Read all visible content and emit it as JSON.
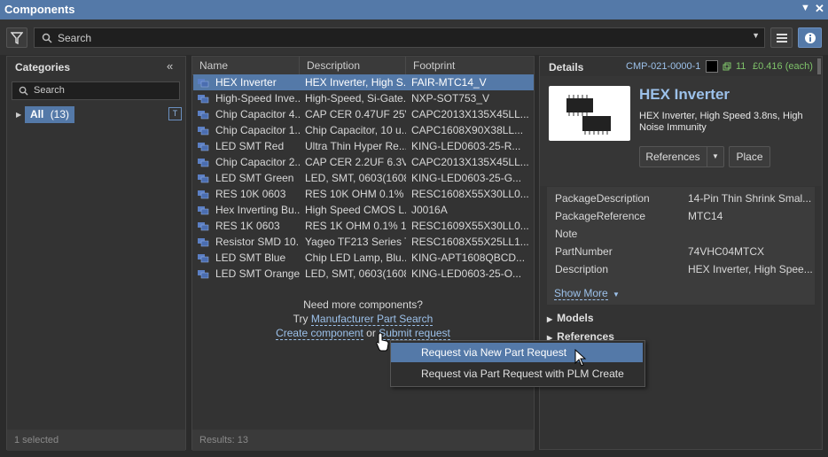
{
  "window": {
    "title": "Components",
    "dropdown_icon": "triangle-down-icon",
    "close_icon": "close-icon"
  },
  "toolbar": {
    "search_placeholder": "Search"
  },
  "categories": {
    "title": "Categories",
    "search_placeholder": "Search",
    "all_label": "All",
    "all_count": "(13)",
    "status": "1 selected"
  },
  "list": {
    "columns": [
      "Name",
      "Description",
      "Footprint"
    ],
    "rows": [
      {
        "name": "HEX Inverter",
        "desc": "HEX Inverter, High S...",
        "fp": "FAIR-MTC14_V"
      },
      {
        "name": "High-Speed Inve...",
        "desc": "High-Speed, Si-Gate...",
        "fp": "NXP-SOT753_V"
      },
      {
        "name": "Chip Capacitor 4...",
        "desc": "CAP CER 0.47UF 25V...",
        "fp": "CAPC2013X135X45LL..."
      },
      {
        "name": "Chip Capacitor 1...",
        "desc": "Chip Capacitor, 10 u...",
        "fp": "CAPC1608X90X38LL..."
      },
      {
        "name": "LED SMT Red",
        "desc": "Ultra Thin Hyper Re...",
        "fp": "KING-LED0603-25-R..."
      },
      {
        "name": "Chip Capacitor 2...",
        "desc": "CAP CER 2.2UF 6.3V...",
        "fp": "CAPC2013X135X45LL..."
      },
      {
        "name": "LED SMT Green",
        "desc": "LED, SMT, 0603(1608...",
        "fp": "KING-LED0603-25-G..."
      },
      {
        "name": "RES 10K 0603",
        "desc": "RES 10K OHM 0.1% ,...",
        "fp": "RESC1608X55X30LL0..."
      },
      {
        "name": "Hex Inverting Bu...",
        "desc": "High Speed CMOS L...",
        "fp": "J0016A"
      },
      {
        "name": "RES 1K 0603",
        "desc": "RES 1K OHM 0.1% 1/...",
        "fp": "RESC1609X55X30LL0..."
      },
      {
        "name": "Resistor SMD 10...",
        "desc": "Yageo TF213 Series T...",
        "fp": "RESC1608X55X25LL1..."
      },
      {
        "name": "LED SMT Blue",
        "desc": "Chip LED Lamp, Blu...",
        "fp": "KING-APT1608QBCD..."
      },
      {
        "name": "LED SMT Orange",
        "desc": "LED, SMT, 0603(1608...",
        "fp": "KING-LED0603-25-O..."
      }
    ],
    "more_text": "Need more components?",
    "try_text": "Try",
    "mps_link": "Manufacturer Part Search",
    "create_link": "Create component",
    "or_text": "or",
    "submit_link": "Submit request",
    "status": "Results: 13"
  },
  "details": {
    "title": "Details",
    "part_id": "CMP-021-0000-1",
    "stock": "11",
    "price": "£0.416 (each)",
    "name": "HEX Inverter",
    "description": "HEX Inverter, High Speed 3.8ns, High Noise Immunity",
    "references_btn": "References",
    "place_btn": "Place",
    "props": [
      {
        "k": "PackageDescription",
        "v": "14-Pin Thin Shrink Smal..."
      },
      {
        "k": "PackageReference",
        "v": "MTC14"
      },
      {
        "k": "Note",
        "v": ""
      },
      {
        "k": "PartNumber",
        "v": "74VHC04MTCX"
      },
      {
        "k": "Description",
        "v": "HEX Inverter, High Spee..."
      }
    ],
    "show_more": "Show More",
    "sections": [
      "Models",
      "References"
    ]
  },
  "context_menu": {
    "items": [
      "Request via New Part Request",
      "Request via Part Request with PLM Create"
    ]
  },
  "colors": {
    "accent": "#5479a8",
    "link": "#9cc1ea",
    "price": "#7fc36a"
  }
}
